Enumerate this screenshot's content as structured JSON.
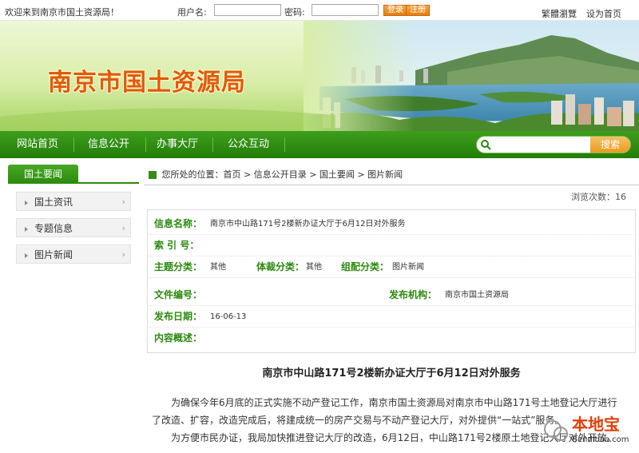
{
  "topbar": {
    "welcome": "欢迎来到南京市国土资源局！",
    "username_label": "用户名:",
    "password_label": "密码:",
    "login_btn": "登录",
    "register_btn": "注册",
    "trad_link": "繁體瀏覽",
    "homepage_link": "设为首页"
  },
  "banner": {
    "site_title": "南京市国土资源局"
  },
  "nav": {
    "items": [
      "网站首页",
      "信息公开",
      "办事大厅",
      "公众互动"
    ],
    "search_placeholder": "",
    "search_btn": "搜索"
  },
  "sidebar": {
    "title": "国土要闻",
    "items": [
      "国土资讯",
      "专题信息",
      "图片新闻"
    ]
  },
  "main": {
    "breadcrumb": "您所处的位置：首页 > 信息公开目录 > 国土要闻 > 图片新闻",
    "views": "浏览次数：16",
    "info": {
      "name_k": "信息名称：",
      "name_v": "南京市中山路171号2楼新办证大厅于6月12日对外服务",
      "index_k": "索 引 号：",
      "topic_k": "主题分类：",
      "topic_v": "其他",
      "genre_k": "体裁分类：",
      "genre_v": "其他",
      "org_class_k": "组配分类：",
      "org_class_v": "图片新闻",
      "docno_k": "文件编号：",
      "publisher_k": "发布机构：",
      "publisher_v": "南京市国土资源局",
      "date_k": "发布日期：",
      "date_v": "16-06-13",
      "summary_k": "内容概述："
    },
    "article_title": "南京市中山路171号2楼新办证大厅于6月12日对外服务",
    "para1": "为确保今年6月底的正式实施不动产登记工作，南京市国土资源局对南京市中山路171号土地登记大厅进行了改造、扩容，改造完成后，将建成统一的房产交易与不动产登记大厅，对外提供“一站式”服务。",
    "para2": "为方便市民办证，我局加快推进登记大厅的改造，6月12日，中山路171号2楼原土地登记大厅对外开放。"
  },
  "watermark": {
    "brand": "本地宝",
    "domain": "Bendibao.com"
  }
}
